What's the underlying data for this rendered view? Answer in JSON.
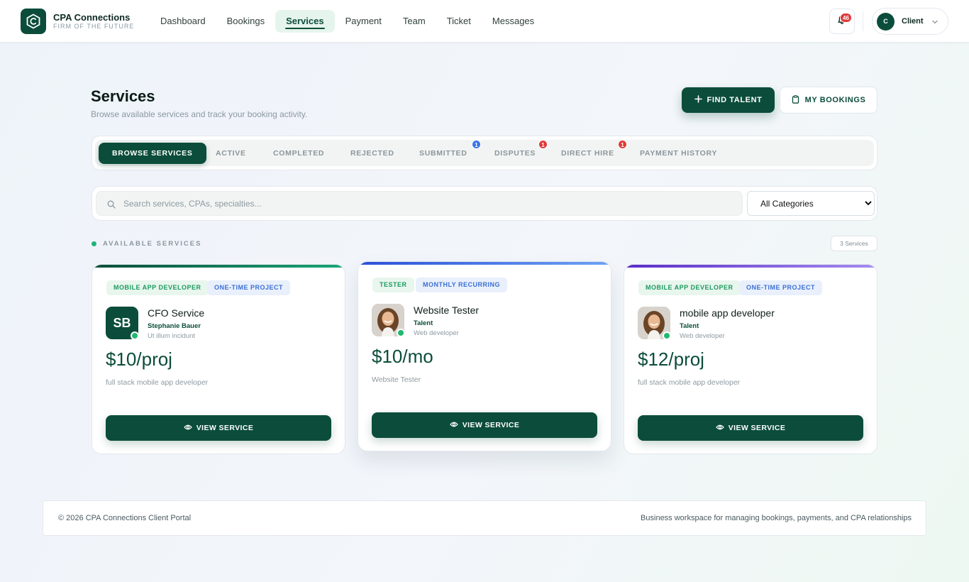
{
  "brand": {
    "name": "CPA Connections",
    "tagline": "FIRM OF THE FUTURE"
  },
  "nav": {
    "items": [
      {
        "label": "Dashboard",
        "active": false
      },
      {
        "label": "Bookings",
        "active": false
      },
      {
        "label": "Services",
        "active": true
      },
      {
        "label": "Payment",
        "active": false
      },
      {
        "label": "Team",
        "active": false
      },
      {
        "label": "Ticket",
        "active": false
      },
      {
        "label": "Messages",
        "active": false
      }
    ],
    "notifications_count": "46",
    "user": {
      "initial": "C",
      "label": "Client"
    }
  },
  "header": {
    "title": "Services",
    "subtitle": "Browse available services and track your booking activity.",
    "find_talent_label": "FIND TALENT",
    "my_bookings_label": "MY BOOKINGS"
  },
  "tabs": [
    {
      "label": "BROWSE SERVICES",
      "active": true,
      "badge": null
    },
    {
      "label": "ACTIVE",
      "active": false,
      "badge": null
    },
    {
      "label": "COMPLETED",
      "active": false,
      "badge": null
    },
    {
      "label": "REJECTED",
      "active": false,
      "badge": null
    },
    {
      "label": "SUBMITTED",
      "active": false,
      "badge": "1"
    },
    {
      "label": "DISPUTES",
      "active": false,
      "badge": "1"
    },
    {
      "label": "DIRECT HIRE",
      "active": false,
      "badge": "1"
    },
    {
      "label": "PAYMENT HISTORY",
      "active": false,
      "badge": null
    }
  ],
  "search": {
    "placeholder": "Search services, CPAs, specialties...",
    "value": "",
    "category_selected": "All Categories"
  },
  "section": {
    "label": "AVAILABLE SERVICES",
    "count_label": "3 Services"
  },
  "cards": [
    {
      "tags": [
        "MOBILE APP DEVELOPER",
        "ONE-TIME PROJECT"
      ],
      "avatar_initials": "SB",
      "title": "CFO Service",
      "provider": "Stephanie Bauer",
      "role": "Ut illum incidunt",
      "price": "$10/proj",
      "description": "full stack mobile app developer",
      "button_label": "VIEW SERVICE"
    },
    {
      "tags": [
        "TESTER",
        "MONTHLY RECURRING"
      ],
      "avatar_initials": "",
      "title": "Website Tester",
      "provider": "Talent",
      "role": "Web developer",
      "price": "$10/mo",
      "description": "Website Tester",
      "button_label": "VIEW SERVICE"
    },
    {
      "tags": [
        "MOBILE APP DEVELOPER",
        "ONE-TIME PROJECT"
      ],
      "avatar_initials": "",
      "title": "mobile app developer",
      "provider": "Talent",
      "role": "Web developer",
      "price": "$12/proj",
      "description": "full stack mobile app developer",
      "button_label": "VIEW SERVICE"
    }
  ],
  "footer": {
    "copyright": "© 2026 CPA Connections Client Portal",
    "tagline": "Business workspace for managing bookings, payments, and CPA relationships"
  },
  "colors": {
    "brand_green": "#0b4d3a",
    "accent_green": "#20b37a",
    "badge_red": "#e03a3a",
    "badge_blue": "#3b74e8"
  }
}
